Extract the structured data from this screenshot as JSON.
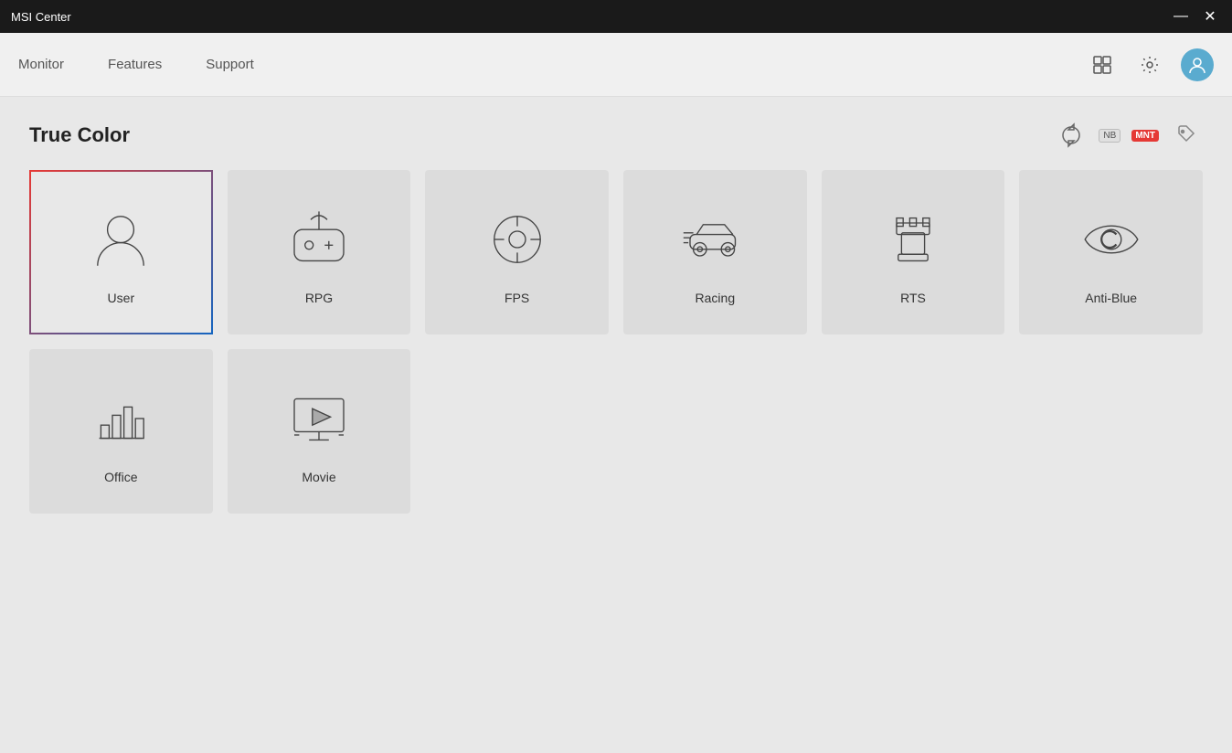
{
  "titleBar": {
    "title": "MSI Center",
    "minimize": "—",
    "close": "✕"
  },
  "nav": {
    "tabs": [
      {
        "label": "Monitor",
        "id": "monitor"
      },
      {
        "label": "Features",
        "id": "features"
      },
      {
        "label": "Support",
        "id": "support"
      }
    ],
    "icons": {
      "grid": "⊞",
      "settings": "⚙",
      "avatar": "👤"
    }
  },
  "section": {
    "title": "True Color",
    "headerIcons": [
      {
        "id": "phone-icon",
        "type": "phone"
      },
      {
        "id": "nb-badge",
        "label": "NB"
      },
      {
        "id": "mnt-badge",
        "label": "MNT"
      },
      {
        "id": "tag-icon",
        "type": "tag"
      }
    ]
  },
  "cards": {
    "row1": [
      {
        "id": "user",
        "label": "User",
        "active": true
      },
      {
        "id": "rpg",
        "label": "RPG",
        "active": false
      },
      {
        "id": "fps",
        "label": "FPS",
        "active": false
      },
      {
        "id": "racing",
        "label": "Racing",
        "active": false
      },
      {
        "id": "rts",
        "label": "RTS",
        "active": false
      },
      {
        "id": "anti-blue",
        "label": "Anti-Blue",
        "active": false
      }
    ],
    "row2": [
      {
        "id": "office",
        "label": "Office",
        "active": false
      },
      {
        "id": "movie",
        "label": "Movie",
        "active": false
      }
    ]
  }
}
